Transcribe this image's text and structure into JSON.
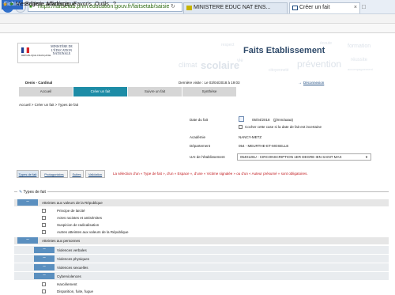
{
  "browser": {
    "url": "https://faitsetab.phm.education.gouv.fr/faitsetab/saisie",
    "tabs": [
      {
        "label": "MINISTERE EDUC NAT ENS..."
      },
      {
        "label": "Créer un fait"
      }
    ],
    "menu": [
      "Fichier",
      "Edition",
      "Affichage",
      "Favoris",
      "Outils",
      "?"
    ],
    "favorite": "Messagerie académique"
  },
  "header": {
    "ministry": "MINISTÈRE DE L'ÉDUCATION NATIONALE",
    "republic": "RÉPUBLIQUE FRANÇAISE",
    "app_title": "Faits Etablissement",
    "background_words": [
      "climat",
      "scolaire",
      "prévention",
      "formation",
      "réussite",
      "vie",
      "respect",
      "écoute",
      "citoyenneté",
      "accompagnement"
    ]
  },
  "userbar": {
    "user": "Denis - Cardinal",
    "last_visit": "Dernière visite : Le 03/04/2018 à 19:03",
    "logout": "Déconnexion"
  },
  "nav": {
    "accueil": "Accueil",
    "creer": "Créer un fait",
    "suivre": "Suivre un fait",
    "synthese": "Synthèse"
  },
  "breadcrumb": "Accueil > Créer un fait > Types de fait",
  "form": {
    "date_label": "Date du fait",
    "date_value": "05/04/2018",
    "date_format": "(jj/mm/aaaa)",
    "uncertain_label": "Cocher cette case si la date de fait est incertaine",
    "academie_label": "Académie",
    "academie_value": "NANCY-METZ",
    "departement_label": "Département",
    "departement_value": "054 - MEURTHE-ET-MOSELLE",
    "uai_label": "UAI de l'établissement",
    "uai_value": "0540126U - CIRCONSCRIPTION 1ER DEGRE IEN SAINT MAX"
  },
  "section_tabs": {
    "type": "Types de fait",
    "protagonistes": "Protagonistes",
    "suites": "Suites",
    "validation": "Validation"
  },
  "validation_msg": "La sélection d'un « Type de fait », d'un « Espace », d'une « Victime signalée » ou d'un « Auteur présumé » sont obligatoires.",
  "types": {
    "legend": "Types de fait",
    "group1": {
      "label": "Atteintes aux valeurs de la République",
      "items": [
        "Principe de laïcité",
        "Actes racistes et antisémites",
        "Suspicion de radicalisation",
        "Autres atteintes aux valeurs de la République"
      ]
    },
    "group2": {
      "label": "Atteintes aux personnes",
      "subgroups": [
        "Violences verbales",
        "Violences physiques",
        "Violences sexuelles"
      ],
      "cyber": "Cyberviolences",
      "cyber_items": [
        "Harcèlement",
        "Disparition, fuite, fugue"
      ]
    },
    "collapse_symbol": "–"
  },
  "colors": {
    "accent": "#1d8ca6",
    "group_button": "#5a8fbf",
    "error": "#c0161b"
  }
}
